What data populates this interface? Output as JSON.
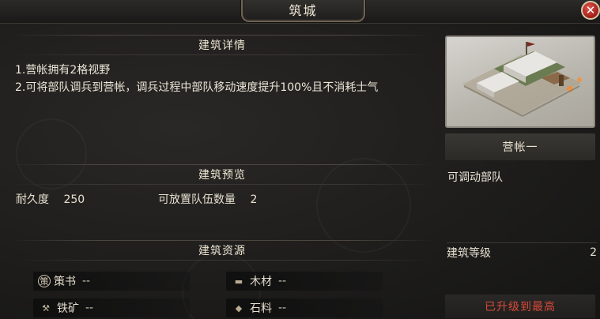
{
  "window": {
    "title": "筑城"
  },
  "sections": {
    "details_title": "建筑详情",
    "preview_title": "建筑预览",
    "resources_title": "建筑资源"
  },
  "details": {
    "line1": "1.营帐拥有2格视野",
    "line2": "2.可将部队调兵到营帐，调兵过程中部队移动速度提升100%且不消耗士气"
  },
  "preview": {
    "durability_label": "耐久度",
    "durability_value": "250",
    "troop_slots_label": "可放置队伍数量",
    "troop_slots_value": "2"
  },
  "resources": [
    {
      "icon": "strategy-book-icon",
      "glyph": "策",
      "name": "策书",
      "value": "--"
    },
    {
      "icon": "wood-icon",
      "glyph": "▬",
      "name": "木材",
      "value": "--"
    },
    {
      "icon": "iron-ore-icon",
      "glyph": "⚒",
      "name": "铁矿",
      "value": "--"
    },
    {
      "icon": "stone-icon",
      "glyph": "◆",
      "name": "石料",
      "value": "--"
    }
  ],
  "building": {
    "name": "营帐一",
    "description": "可调动部队",
    "level_label": "建筑等级",
    "level_value": "2",
    "max_level_text": "已升级到最高"
  },
  "colors": {
    "background": "#1c1b1a",
    "text": "#e9e2d3",
    "max_level_red": "#d84a3a",
    "close_red": "#a01d18"
  }
}
